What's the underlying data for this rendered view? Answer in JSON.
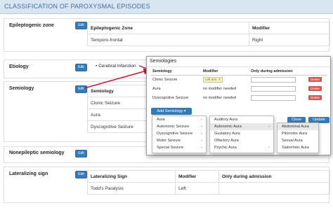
{
  "header": {
    "title": "CLASSIFICATION OF PAROXYSMAL EPISODES"
  },
  "edit_label": "Edit",
  "epileptogenic": {
    "label": "Epileptogenic zone",
    "col1": "Epileptogenic Zone",
    "col2": "Modifier",
    "value": "Temporo-frontal",
    "modifier": "Right"
  },
  "etiology": {
    "label": "Etiology",
    "item": "Cerebral Infarction"
  },
  "semiology": {
    "label": "Semiology",
    "header": "Semiology",
    "rows": [
      "Clonic Seizure",
      "Aura",
      "Dyscognitive Seizure"
    ]
  },
  "nonepileptic": {
    "label": "Nonepileptic semiology"
  },
  "lateralizing": {
    "label": "Lateralizing sign",
    "col1": "Lateralizing Sign",
    "col2": "Modifier",
    "col3": "Only during admission",
    "value": "Todd's Paralysis",
    "modifier": "Left"
  },
  "popup": {
    "title": "Semiologies",
    "col1": "Semiology",
    "col2": "Modifier",
    "col3": "Only during admission",
    "rows": [
      {
        "semiology": "Clonic Seizure",
        "modifier_tag": "Left arm",
        "modifier_text": ""
      },
      {
        "semiology": "Aura",
        "modifier_tag": "",
        "modifier_text": "no modifier needed"
      },
      {
        "semiology": "Dyscognitive Seizure",
        "modifier_tag": "",
        "modifier_text": "no modifier needed"
      }
    ],
    "delete_label": "Delete",
    "add_label": "Add Semiology",
    "close_label": "Close",
    "update_label": "Update"
  },
  "menu1": [
    {
      "label": "Aura",
      "sub": true
    },
    {
      "label": "Autonomic Seizure",
      "sub": true
    },
    {
      "label": "Dyscognitive Seizure",
      "sub": true
    },
    {
      "label": "Motor Seizure",
      "sub": true
    },
    {
      "label": "Special Seizure",
      "sub": true
    }
  ],
  "menu2": [
    {
      "label": "Auditory Aura",
      "sub": false
    },
    {
      "label": "Autonomic Aura",
      "sub": true
    },
    {
      "label": "Gustatory Aura",
      "sub": false
    },
    {
      "label": "Olfactory Aura",
      "sub": false
    },
    {
      "label": "Psychic Aura",
      "sub": true
    }
  ],
  "menu3": [
    {
      "label": "Abdominal Aura"
    },
    {
      "label": "Pilomotor Aura"
    },
    {
      "label": "Sexual Aura"
    },
    {
      "label": "Sialorrheic Aura"
    }
  ],
  "colors": {
    "accent": "#337ab7",
    "danger": "#d9534f",
    "arrow": "#c8102e"
  }
}
